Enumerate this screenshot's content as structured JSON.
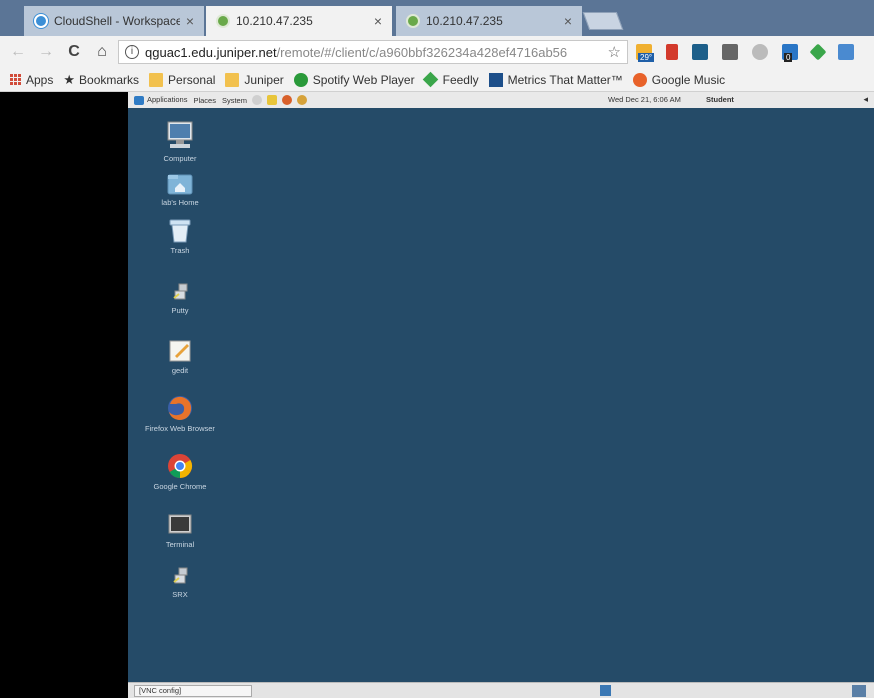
{
  "tabs": [
    {
      "title": "CloudShell - Workspace",
      "close": "×"
    },
    {
      "title": "10.210.47.235",
      "close": "×"
    },
    {
      "title": "10.210.47.235",
      "close": "×"
    }
  ],
  "toolbar": {
    "back": "←",
    "forward": "→",
    "reload": "C",
    "home": "⌂",
    "url_host": "qguac1.edu.juniper.net",
    "url_path": "/remote/#/client/c/a960bbf326234a428ef4716ab56",
    "bookmark_star": "☆",
    "weather_badge": "29°",
    "ext_badge": "0"
  },
  "bookmarks": [
    {
      "label": "Apps"
    },
    {
      "label": "Bookmarks"
    },
    {
      "label": "Personal"
    },
    {
      "label": "Juniper"
    },
    {
      "label": "Spotify Web Player"
    },
    {
      "label": "Feedly"
    },
    {
      "label": "Metrics That Matter™"
    },
    {
      "label": "Google Music"
    }
  ],
  "remote": {
    "panel": {
      "applications": "Applications",
      "places": "Places",
      "system": "System",
      "clock": "Wed Dec 21, 6:06 AM",
      "user": "Student"
    },
    "icons": [
      {
        "label": "Computer"
      },
      {
        "label": "lab's Home"
      },
      {
        "label": "Trash"
      },
      {
        "label": "Putty"
      },
      {
        "label": "gedit"
      },
      {
        "label": "Firefox Web Browser"
      },
      {
        "label": "Google Chrome"
      },
      {
        "label": "Terminal"
      },
      {
        "label": "SRX"
      }
    ],
    "taskbar_item": "[VNC config]"
  },
  "colors": {
    "desktop_bg": "#254b68",
    "tabstrip_bg": "#5b7596"
  }
}
